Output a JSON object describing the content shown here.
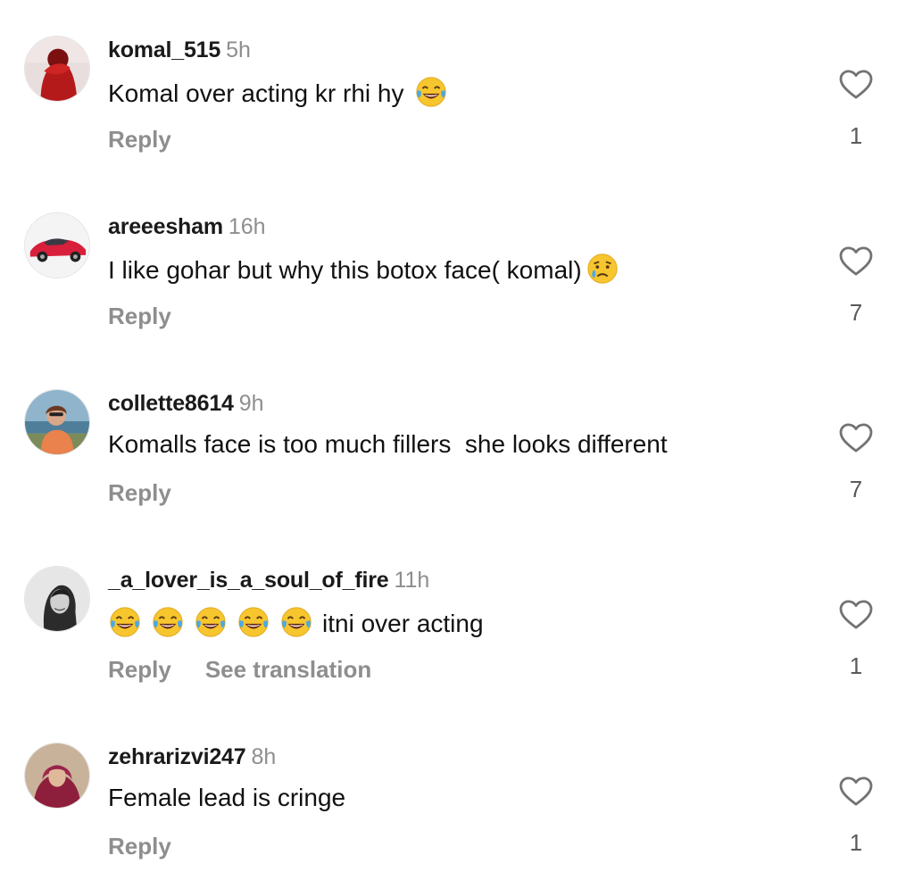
{
  "comments": [
    {
      "username": "komal_515",
      "time": "5h",
      "text": "Komal over acting kr rhi hy",
      "trailing_emoji": "face-with-tears-of-joy",
      "reply_label": "Reply",
      "likes": "1"
    },
    {
      "username": "areeesham",
      "time": "16h",
      "text": "I like gohar but why this botox face( komal)",
      "trailing_emoji": "crying-face",
      "reply_label": "Reply",
      "likes": "7"
    },
    {
      "username": "collette8614",
      "time": "9h",
      "text": "Komalls face is too much fillers  she looks different",
      "reply_label": "Reply",
      "likes": "7"
    },
    {
      "username": "_a_lover_is_a_soul_of_fire",
      "time": "11h",
      "leading_emojis": [
        "face-with-tears-of-joy",
        "face-with-tears-of-joy",
        "face-with-tears-of-joy",
        "face-with-tears-of-joy",
        "face-with-tears-of-joy"
      ],
      "text": "itni over acting",
      "reply_label": "Reply",
      "translation_label": "See translation",
      "likes": "1"
    },
    {
      "username": "zehrarizvi247",
      "time": "8h",
      "text": "Female lead is cringe",
      "reply_label": "Reply",
      "likes": "1"
    }
  ],
  "icons": {
    "like": "heart-outline-icon",
    "avatar": "user-avatar"
  },
  "colors": {
    "muted": "#8e8e8e",
    "text": "#111111"
  }
}
